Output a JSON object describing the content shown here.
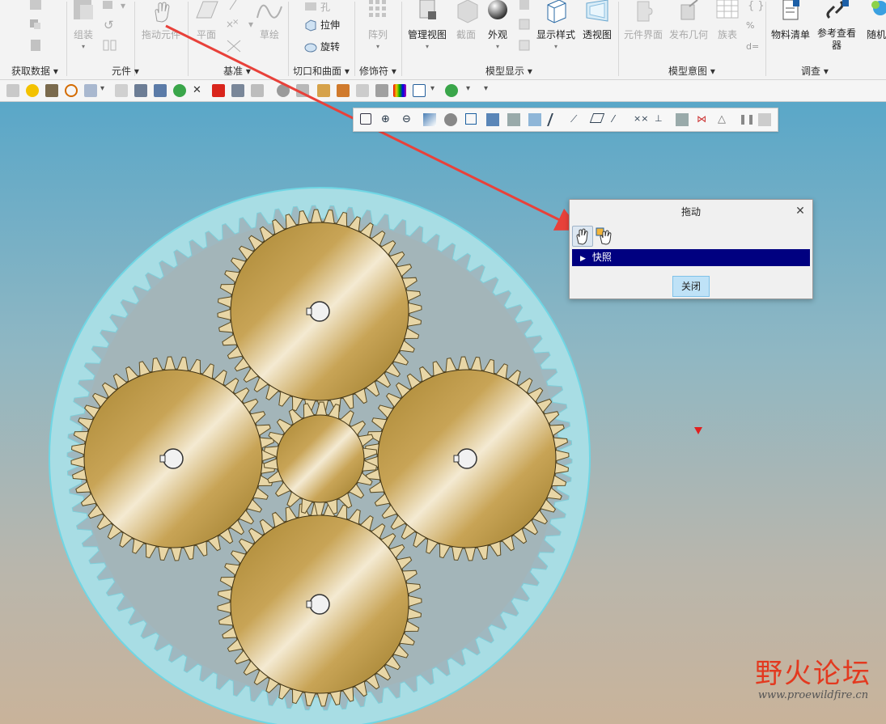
{
  "ribbon": {
    "groups": [
      {
        "label": "获取数据"
      },
      {
        "label": "元件"
      },
      {
        "label": "基准"
      },
      {
        "label": "切口和曲面"
      },
      {
        "label": "修饰符"
      },
      {
        "label": "模型显示"
      },
      {
        "label": "模型意图"
      },
      {
        "label": "调查"
      }
    ],
    "buttons": {
      "assemble": "组装",
      "drag_component": "拖动元件",
      "plane": "平面",
      "sketch": "草绘",
      "extrude": "拉伸",
      "revolve": "旋转",
      "hole": "孔",
      "pattern": "阵列",
      "manage_views": "管理视图",
      "section": "截面",
      "appearance": "外观",
      "display_style": "显示样式",
      "perspective": "透视图",
      "component_interface": "元件界面",
      "publish_geometry": "发布几何",
      "family_table": "族表",
      "bom": "物料清单",
      "reference_viewer": "参考查看器",
      "random": "随机"
    }
  },
  "dialog": {
    "title": "拖动",
    "section": "快照",
    "close_button": "关闭",
    "tools": [
      "drag-point-icon",
      "drag-body-icon"
    ]
  },
  "watermark": {
    "main": "野火论坛",
    "url": "www.proewildfire.cn"
  },
  "colors": {
    "gear_gold": "#c8a456",
    "ring_gear": "#a8dde4",
    "dialog_section": "#000080",
    "arrow": "#e8413a"
  }
}
